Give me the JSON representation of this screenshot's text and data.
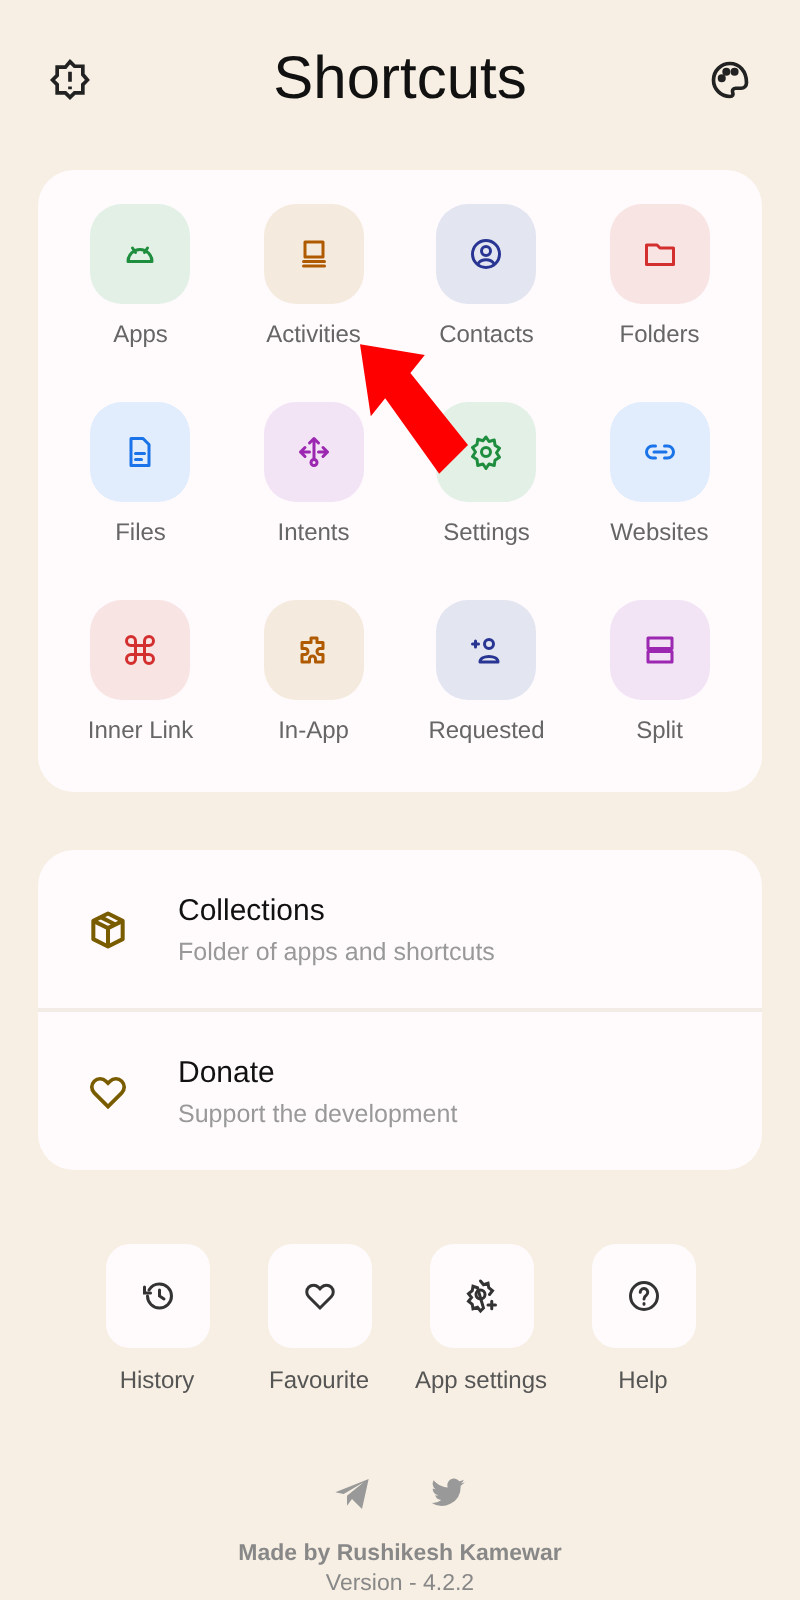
{
  "header": {
    "title": "Shortcuts"
  },
  "shortcuts": [
    {
      "label": "Apps",
      "color": "#1e8e3e"
    },
    {
      "label": "Activities",
      "color": "#b05a00"
    },
    {
      "label": "Contacts",
      "color": "#283593"
    },
    {
      "label": "Folders",
      "color": "#d32f2f"
    },
    {
      "label": "Files",
      "color": "#1a73e8"
    },
    {
      "label": "Intents",
      "color": "#9c27b0"
    },
    {
      "label": "Settings",
      "color": "#1e8e3e"
    },
    {
      "label": "Websites",
      "color": "#1a73e8"
    },
    {
      "label": "Inner Link",
      "color": "#d32f2f"
    },
    {
      "label": "In-App",
      "color": "#b05a00"
    },
    {
      "label": "Requested",
      "color": "#283593"
    },
    {
      "label": "Split",
      "color": "#9c27b0"
    }
  ],
  "list": [
    {
      "title": "Collections",
      "subtitle": "Folder of apps and shortcuts"
    },
    {
      "title": "Donate",
      "subtitle": "Support the development"
    }
  ],
  "actions": [
    {
      "label": "History"
    },
    {
      "label": "Favourite"
    },
    {
      "label": "App settings"
    },
    {
      "label": "Help"
    }
  ],
  "footer": {
    "credit": "Made by Rushikesh Kamewar",
    "version": "Version - 4.2.2"
  }
}
